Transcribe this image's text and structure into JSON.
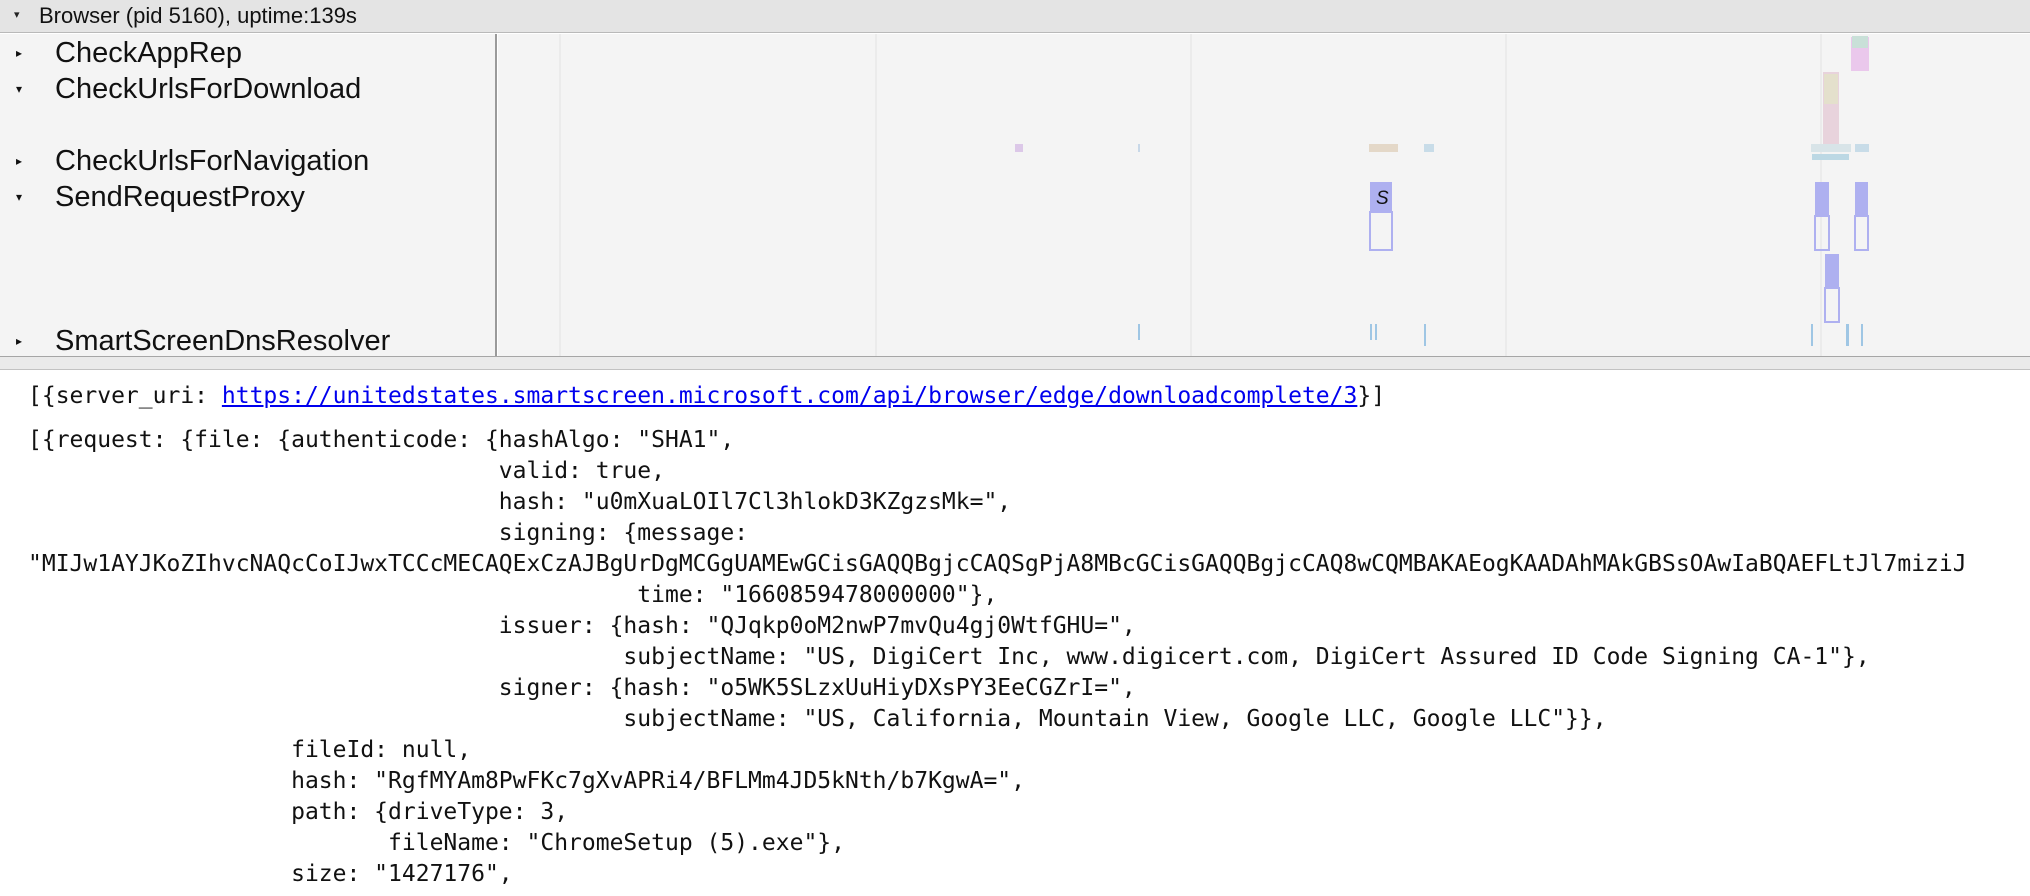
{
  "process": {
    "title": "Browser (pid 5160), uptime:139s",
    "expand_glyph": "▾"
  },
  "tracks": [
    {
      "label": "CheckAppRep",
      "expanded": false,
      "glyph": "▸"
    },
    {
      "label": "CheckUrlsForDownload",
      "expanded": true,
      "glyph": "▾"
    },
    {
      "label": "CheckUrlsForNavigation",
      "expanded": false,
      "glyph": "▸"
    },
    {
      "label": "SendRequestProxy",
      "expanded": true,
      "glyph": "▾"
    },
    {
      "label": "SmartScreenDnsResolver",
      "expanded": false,
      "glyph": "▸"
    }
  ],
  "timeline": {
    "slice_label": "S",
    "colors": {
      "send_request": "#aeb0f0",
      "app_rep": "#eac8ec",
      "download": "#e8d3dc",
      "navigation": "#c8d8e8",
      "dns": "#9fc6e4"
    }
  },
  "details": {
    "server_uri_prefix": "[{server_uri: ",
    "server_uri_link": "https://unitedstates.smartscreen.microsoft.com/api/browser/edge/downloadcomplete/3",
    "server_uri_suffix": "}]",
    "request_lines": [
      "[{request: {file: {authenticode: {hashAlgo: \"SHA1\",",
      "                                  valid: true,",
      "                                  hash: \"u0mXuaLOIl7Cl3hlokD3KZgzsMk=\",",
      "                                  signing: {message:",
      "\"MIJw1AYJKoZIhvcNAQcCoIJwxTCCcMECAQExCzAJBgUrDgMCGgUAMEwGCisGAQQBgjcCAQSgPjA8MBcGCisGAQQBgjcCAQ8wCQMBAKAEogKAADAhMAkGBSsOAwIaBQAEFLtJl7miziJ",
      "                                            time: \"1660859478000000\"},",
      "                                  issuer: {hash: \"QJqkp0oM2nwP7mvQu4gj0WtfGHU=\",",
      "                                           subjectName: \"US, DigiCert Inc, www.digicert.com, DigiCert Assured ID Code Signing CA-1\"},",
      "                                  signer: {hash: \"o5WK5SLzxUuHiyDXsPY3EeCGZrI=\",",
      "                                           subjectName: \"US, California, Mountain View, Google LLC, Google LLC\"}},",
      "                   fileId: null,",
      "                   hash: \"RgfMYAm8PwFKc7gXvAPRi4/BFLMm4JD5kNth/b7KgwA=\",",
      "                   path: {driveType: 3,",
      "                          fileName: \"ChromeSetup (5).exe\"},",
      "                   size: \"1427176\","
    ]
  }
}
